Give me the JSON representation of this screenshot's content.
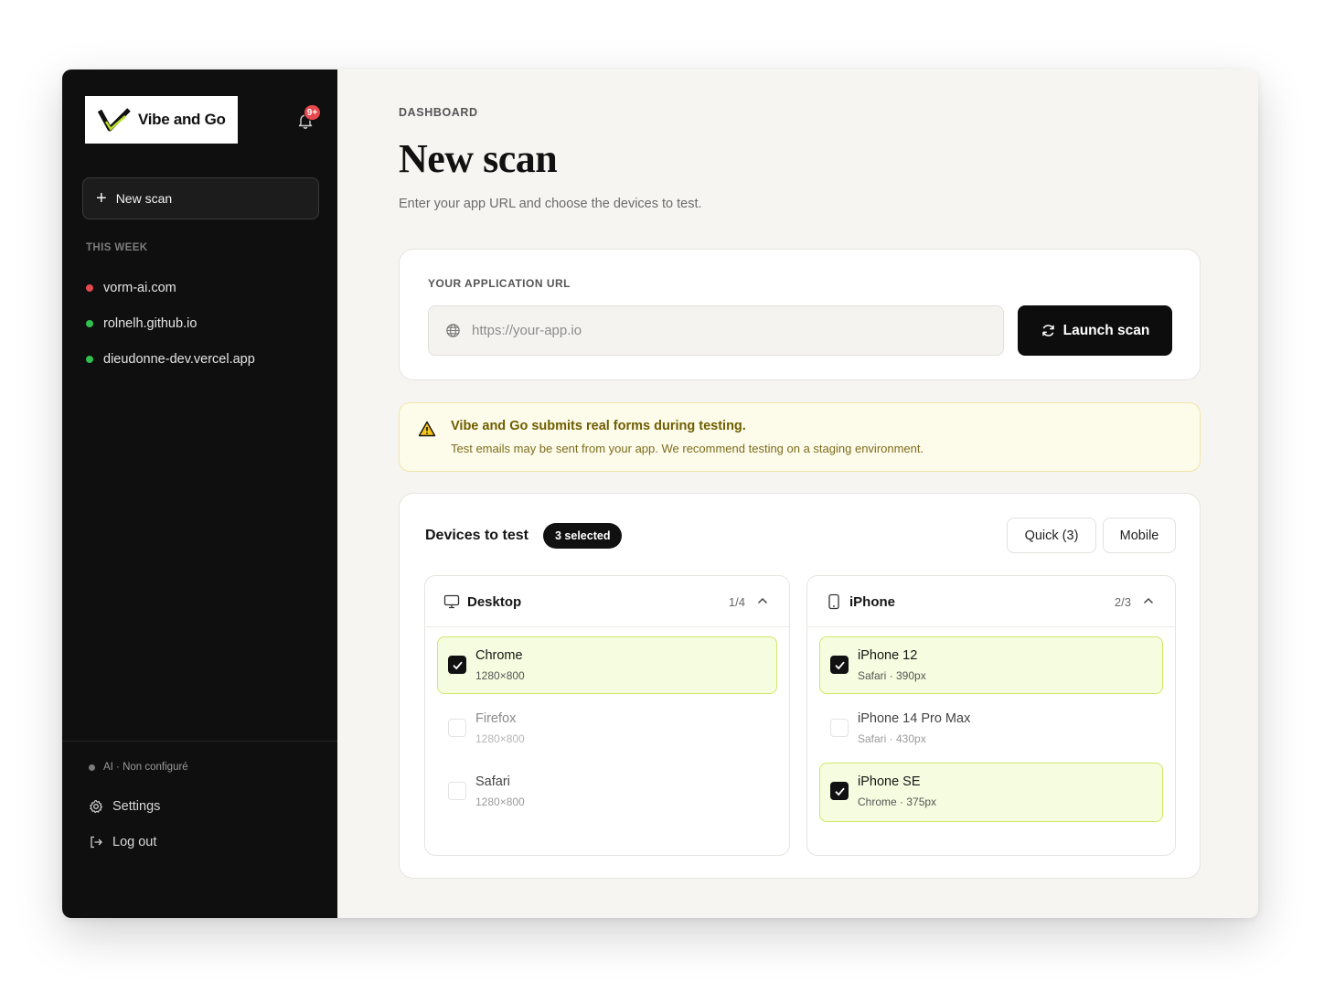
{
  "brand": {
    "name": "Vibe and Go",
    "logo_icon": "v-checkmark-logo"
  },
  "notifications": {
    "badge": "9+",
    "icon": "bell-icon"
  },
  "sidebar": {
    "new_scan_label": "New scan",
    "section_label": "THIS WEEK",
    "history": [
      {
        "label": "vorm-ai.com",
        "status_color": "#e5484d"
      },
      {
        "label": "rolnelh.github.io",
        "status_color": "#30c04f"
      },
      {
        "label": "dieudonne-dev.vercel.app",
        "status_color": "#30c04f"
      }
    ],
    "ai_status": "AI · Non configuré",
    "settings_label": "Settings",
    "logout_label": "Log out"
  },
  "header": {
    "breadcrumb": "DASHBOARD",
    "title": "New scan",
    "subtitle": "Enter your app URL and choose the devices to test."
  },
  "url_form": {
    "label": "YOUR APPLICATION URL",
    "placeholder": "https://your-app.io",
    "value": "",
    "launch_label": "Launch scan"
  },
  "warning": {
    "title": "Vibe and Go submits real forms during testing.",
    "text": "Test emails may be sent from your app. We recommend testing on a staging environment."
  },
  "devices": {
    "title": "Devices to test",
    "selected_badge": "3 selected",
    "presets": [
      "Quick (3)",
      "Mobile"
    ],
    "groups": [
      {
        "name": "Desktop",
        "count": "1/4",
        "items": [
          {
            "name": "Chrome",
            "detail": "1280×800",
            "checked": true
          },
          {
            "name": "Firefox",
            "detail": "1280×800",
            "checked": false
          },
          {
            "name": "Safari",
            "detail": "1280×800",
            "checked": false
          }
        ]
      },
      {
        "name": "iPhone",
        "count": "2/3",
        "items": [
          {
            "name": "iPhone 12",
            "detail": "Safari · 390px",
            "checked": true
          },
          {
            "name": "iPhone 14 Pro Max",
            "detail": "Safari · 430px",
            "checked": false
          },
          {
            "name": "iPhone SE",
            "detail": "Chrome · 375px",
            "checked": true
          }
        ]
      }
    ]
  },
  "colors": {
    "accent_lime": "#cfe86a",
    "sidebar_bg": "#0f0f0f",
    "warning_bg": "#fdfbe9"
  }
}
